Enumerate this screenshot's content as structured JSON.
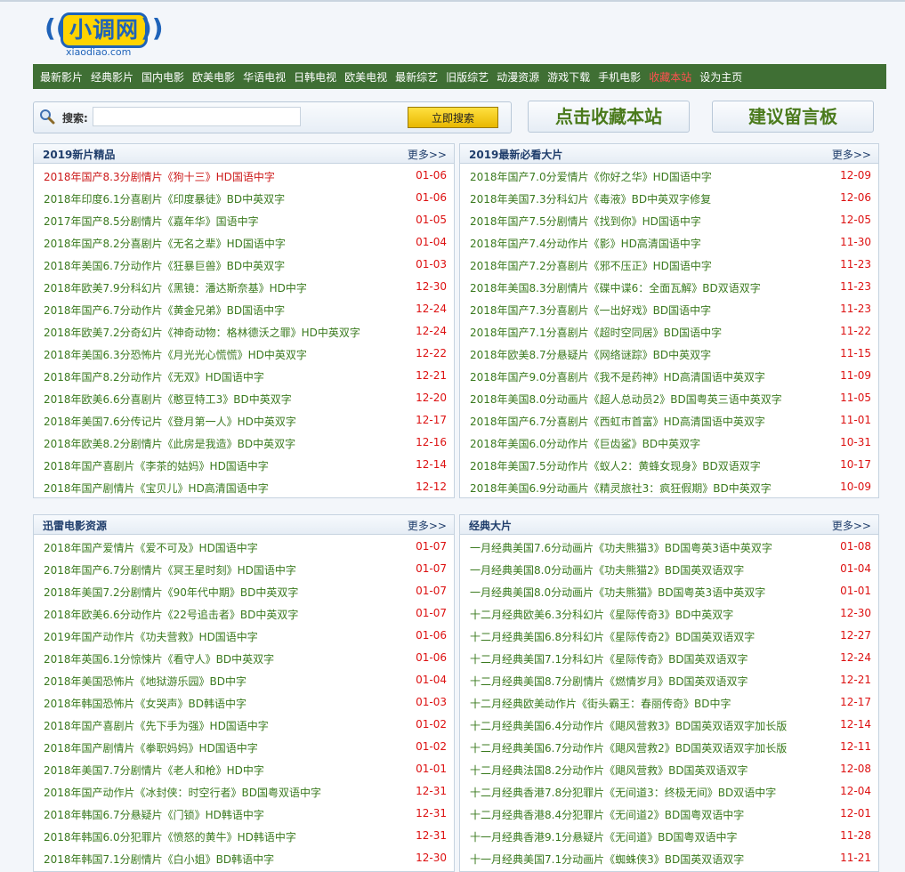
{
  "logo": {
    "text": "小调网",
    "domain": "xiaodiao.com"
  },
  "nav": [
    "最新影片",
    "经典影片",
    "国内电影",
    "欧美电影",
    "华语电视",
    "日韩电视",
    "欧美电视",
    "最新综艺",
    "旧版综艺",
    "动漫资源",
    "游戏下载",
    "手机电影",
    "收藏本站",
    "设为主页"
  ],
  "search": {
    "label": "搜索:",
    "value": "",
    "button": "立即搜索"
  },
  "fav_button": "点击收藏本站",
  "message_button": "建议留言板",
  "more": "更多>>",
  "panels": [
    {
      "title": "2019新片精品",
      "items": [
        {
          "t": "2018年国产8.3分剧情片《狗十三》HD国语中字",
          "d": "01-06",
          "hot": true
        },
        {
          "t": "2018年印度6.1分喜剧片《印度暴徒》BD中英双字",
          "d": "01-06"
        },
        {
          "t": "2017年国产8.5分剧情片《嘉年华》国语中字",
          "d": "01-05"
        },
        {
          "t": "2018年国产8.2分喜剧片《无名之辈》HD国语中字",
          "d": "01-04"
        },
        {
          "t": "2018年美国6.7分动作片《狂暴巨兽》BD中英双字",
          "d": "01-03"
        },
        {
          "t": "2018年欧美7.9分科幻片《黑镜：潘达斯奈基》HD中字",
          "d": "12-30"
        },
        {
          "t": "2018年国产6.7分动作片《黄金兄弟》BD国语中字",
          "d": "12-24"
        },
        {
          "t": "2018年欧美7.2分奇幻片《神奇动物：格林德沃之罪》HD中英双字",
          "d": "12-24"
        },
        {
          "t": "2018年美国6.3分恐怖片《月光光心慌慌》HD中英双字",
          "d": "12-22"
        },
        {
          "t": "2018年国产8.2分动作片《无双》HD国语中字",
          "d": "12-21"
        },
        {
          "t": "2018年欧美6.6分喜剧片《憨豆特工3》BD中英双字",
          "d": "12-20"
        },
        {
          "t": "2018年美国7.6分传记片《登月第一人》HD中英双字",
          "d": "12-17"
        },
        {
          "t": "2018年欧美8.2分剧情片《此房是我造》BD中英双字",
          "d": "12-16"
        },
        {
          "t": "2018年国产喜剧片《李茶的姑妈》HD国语中字",
          "d": "12-14"
        },
        {
          "t": "2018年国产剧情片《宝贝儿》HD高清国语中字",
          "d": "12-12"
        }
      ]
    },
    {
      "title": "2019最新必看大片",
      "items": [
        {
          "t": "2018年国产7.0分爱情片《你好之华》HD国语中字",
          "d": "12-09"
        },
        {
          "t": "2018年美国7.3分科幻片《毒液》BD中英双字修复",
          "d": "12-06"
        },
        {
          "t": "2018年国产7.5分剧情片《找到你》HD国语中字",
          "d": "12-05"
        },
        {
          "t": "2018年国产7.4分动作片《影》HD高清国语中字",
          "d": "11-30"
        },
        {
          "t": "2018年国产7.2分喜剧片《邪不压正》HD国语中字",
          "d": "11-23"
        },
        {
          "t": "2018年美国8.3分剧情片《碟中谍6：全面瓦解》BD双语双字",
          "d": "11-23"
        },
        {
          "t": "2018年国产7.3分喜剧片《一出好戏》BD国语中字",
          "d": "11-23"
        },
        {
          "t": "2018年国产7.1分喜剧片《超时空同居》BD国语中字",
          "d": "11-22"
        },
        {
          "t": "2018年欧美8.7分悬疑片《网络谜踪》BD中英双字",
          "d": "11-15"
        },
        {
          "t": "2018年国产9.0分喜剧片《我不是药神》HD高清国语中英双字",
          "d": "11-09"
        },
        {
          "t": "2018年美国8.0分动画片《超人总动员2》BD国粤英三语中英双字",
          "d": "11-05"
        },
        {
          "t": "2018年国产6.7分喜剧片《西虹市首富》HD高清国语中英双字",
          "d": "11-01"
        },
        {
          "t": "2018年美国6.0分动作片《巨齿鲨》BD中英双字",
          "d": "10-31"
        },
        {
          "t": "2018年美国7.5分动作片《蚁人2：黄蜂女现身》BD双语双字",
          "d": "10-17"
        },
        {
          "t": "2018年美国6.9分动画片《精灵旅社3：疯狂假期》BD中英双字",
          "d": "10-09"
        }
      ]
    },
    {
      "title": "迅雷电影资源",
      "items": [
        {
          "t": "2018年国产爱情片《爱不可及》HD国语中字",
          "d": "01-07"
        },
        {
          "t": "2018年国产6.7分剧情片《冥王星时刻》HD国语中字",
          "d": "01-07"
        },
        {
          "t": "2018年美国7.2分剧情片《90年代中期》BD中英双字",
          "d": "01-07"
        },
        {
          "t": "2018年欧美6.6分动作片《22号追击者》BD中英双字",
          "d": "01-07"
        },
        {
          "t": "2019年国产动作片《功夫营救》HD国语中字",
          "d": "01-06"
        },
        {
          "t": "2018年英国6.1分惊悚片《看守人》BD中英双字",
          "d": "01-06"
        },
        {
          "t": "2018年美国恐怖片《地狱游乐园》BD中字",
          "d": "01-04"
        },
        {
          "t": "2018年韩国恐怖片《女哭声》BD韩语中字",
          "d": "01-03"
        },
        {
          "t": "2018年国产喜剧片《先下手为强》HD国语中字",
          "d": "01-02"
        },
        {
          "t": "2018年国产剧情片《拳职妈妈》HD国语中字",
          "d": "01-02"
        },
        {
          "t": "2018年美国7.7分剧情片《老人和枪》HD中字",
          "d": "01-01"
        },
        {
          "t": "2018年国产动作片《冰封侠：时空行者》BD国粤双语中字",
          "d": "12-31"
        },
        {
          "t": "2018年韩国6.7分悬疑片《门锁》HD韩语中字",
          "d": "12-31"
        },
        {
          "t": "2018年韩国6.0分犯罪片《愤怒的黄牛》HD韩语中字",
          "d": "12-31"
        },
        {
          "t": "2018年韩国7.1分剧情片《白小姐》BD韩语中字",
          "d": "12-30"
        }
      ]
    },
    {
      "title": "经典大片",
      "items": [
        {
          "t": "一月经典美国7.6分动画片《功夫熊猫3》BD国粤英3语中英双字",
          "d": "01-08"
        },
        {
          "t": "一月经典美国8.0分动画片《功夫熊猫2》BD国英双语双字",
          "d": "01-04"
        },
        {
          "t": "一月经典美国8.0分动画片《功夫熊猫》BD国粤英3语中英双字",
          "d": "01-01"
        },
        {
          "t": "十二月经典欧美6.3分科幻片《星际传奇3》BD中英双字",
          "d": "12-30"
        },
        {
          "t": "十二月经典美国6.8分科幻片《星际传奇2》BD国英双语双字",
          "d": "12-27"
        },
        {
          "t": "十二月经典美国7.1分科幻片《星际传奇》BD国英双语双字",
          "d": "12-24"
        },
        {
          "t": "十二月经典美国8.7分剧情片《燃情岁月》BD国英双语双字",
          "d": "12-21"
        },
        {
          "t": "十二月经典欧美动作片《街头霸王：春丽传奇》BD中字",
          "d": "12-17"
        },
        {
          "t": "十二月经典美国6.4分动作片《飓风营救3》BD国英双语双字加长版",
          "d": "12-14"
        },
        {
          "t": "十二月经典美国6.7分动作片《飓风营救2》BD国英双语双字加长版",
          "d": "12-11"
        },
        {
          "t": "十二月经典法国8.2分动作片《飓风营救》BD国英双语双字",
          "d": "12-08"
        },
        {
          "t": "十二月经典香港7.8分犯罪片《无间道3：终极无间》BD双语中字",
          "d": "12-04"
        },
        {
          "t": "十二月经典香港8.4分犯罪片《无间道2》BD国粤双语中字",
          "d": "12-01"
        },
        {
          "t": "十一月经典香港9.1分悬疑片《无间道》BD国粤双语中字",
          "d": "11-28"
        },
        {
          "t": "十一月经典美国7.1分动画片《蜘蛛侠3》BD国英双语双字",
          "d": "11-21"
        }
      ]
    }
  ]
}
